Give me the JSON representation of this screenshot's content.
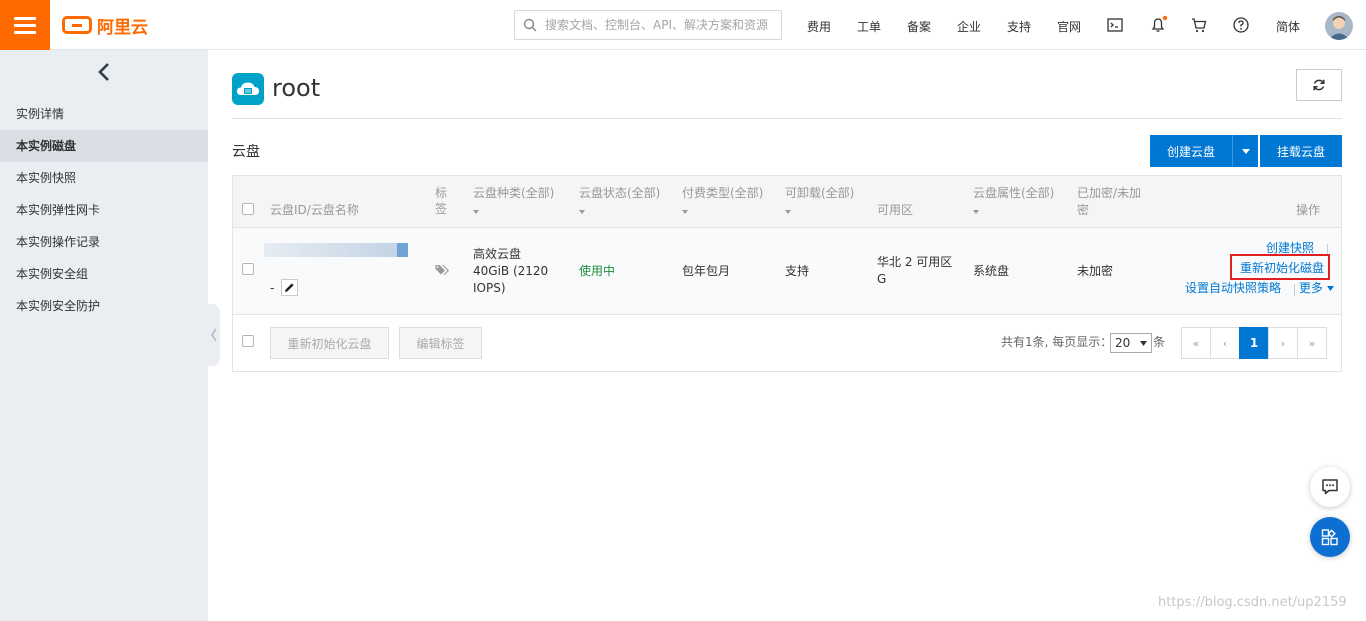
{
  "brand": {
    "logo_text": "阿里云",
    "accent": "#ff6a00"
  },
  "search": {
    "placeholder": "搜索文档、控制台、API、解决方案和资源"
  },
  "topnav": {
    "items": [
      "费用",
      "工单",
      "备案",
      "企业",
      "支持",
      "官网"
    ],
    "language": "简体"
  },
  "topnav_icons": [
    "terminal-icon",
    "bell-icon",
    "cart-icon",
    "help-icon"
  ],
  "sidebar": {
    "items": [
      {
        "label": "实例详情",
        "active": false
      },
      {
        "label": "本实例磁盘",
        "active": true
      },
      {
        "label": "本实例快照",
        "active": false
      },
      {
        "label": "本实例弹性网卡",
        "active": false
      },
      {
        "label": "本实例操作记录",
        "active": false
      },
      {
        "label": "本实例安全组",
        "active": false
      },
      {
        "label": "本实例安全防护",
        "active": false
      }
    ]
  },
  "page": {
    "title": "root",
    "section_title": "云盘"
  },
  "actions": {
    "create_disk": "创建云盘",
    "attach_disk": "挂载云盘"
  },
  "table": {
    "columns": {
      "id_name": "云盘ID/云盘名称",
      "tag": "标签",
      "type": "云盘种类(全部)",
      "status": "云盘状态(全部)",
      "billing": "付费类型(全部)",
      "detachable": "可卸载(全部)",
      "zone": "可用区",
      "attribute": "云盘属性(全部)",
      "encrypted": "已加密/未加密",
      "ops": "操作"
    },
    "row": {
      "name": "-",
      "type_line1": "高效云盘",
      "type_line2": "40GiB (2120",
      "type_line3": "IOPS)",
      "status": "使用中",
      "billing": "包年包月",
      "detachable": "支持",
      "zone_line1": "华北 2 可用区",
      "zone_line2": "G",
      "attribute": "系统盘",
      "encrypted": "未加密",
      "op_snapshot": "创建快照",
      "op_reinit": "重新初始化磁盘",
      "op_policy": "设置自动快照策略",
      "op_more": "更多"
    },
    "batch": {
      "reinit": "重新初始化云盘",
      "edit_tags": "编辑标签"
    },
    "pagination": {
      "summary": "共有1条, 每页显示：",
      "page_size": "20",
      "unit": "条",
      "first": "«",
      "prev": "‹",
      "current": "1",
      "next": "›",
      "last": "»"
    }
  },
  "watermark": "https://blog.csdn.net/up2159",
  "colors": {
    "primary": "#0077d2",
    "status_ok": "#1e8e3e",
    "highlight": "#e02020"
  }
}
